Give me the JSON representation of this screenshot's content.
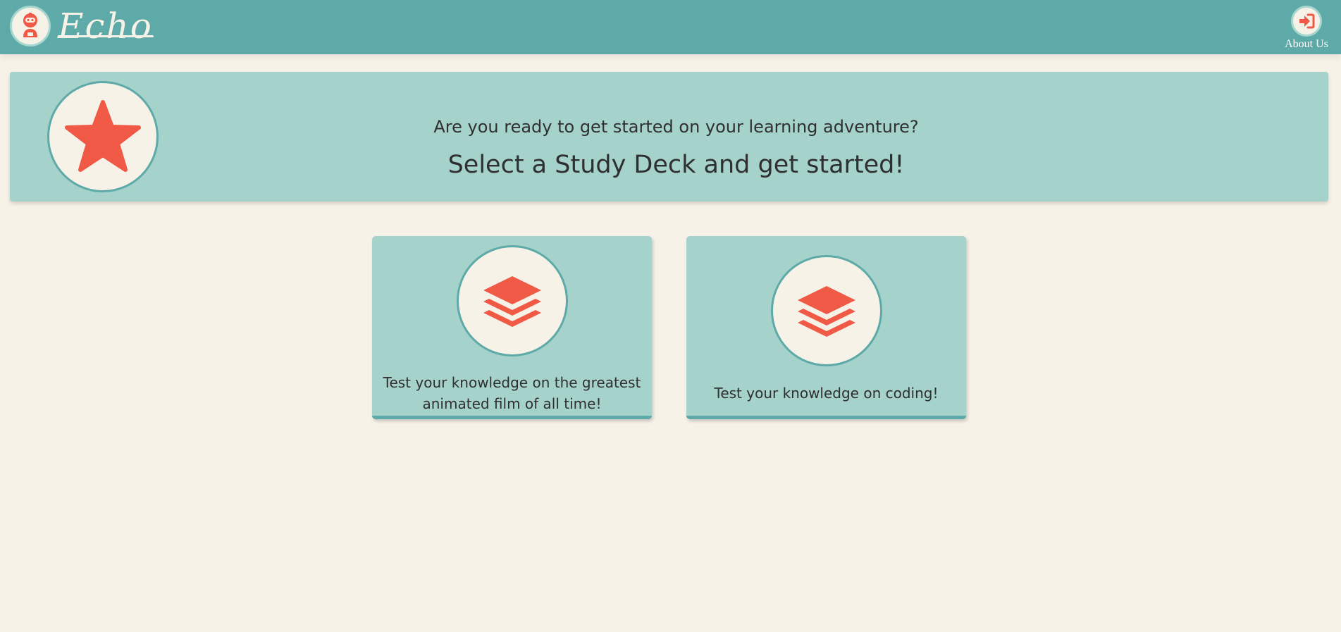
{
  "header": {
    "brand": "Echo",
    "about_label": "About Us",
    "logo_icon": "robot-icon",
    "about_icon": "sign-in-icon"
  },
  "hero": {
    "icon": "star-icon",
    "subtitle": "Are you ready to get started on your learning adventure?",
    "title": "Select a Study Deck and get started!"
  },
  "decks": [
    {
      "icon": "layers-icon",
      "description": "Test your knowledge on the greatest animated film of all time!"
    },
    {
      "icon": "layers-icon",
      "description": "Test your knowledge on coding!"
    }
  ],
  "colors": {
    "header_bg": "#5eaaa8",
    "panel_bg": "#a5d2cb",
    "page_bg": "#f7f2e8",
    "accent": "#f05945"
  }
}
